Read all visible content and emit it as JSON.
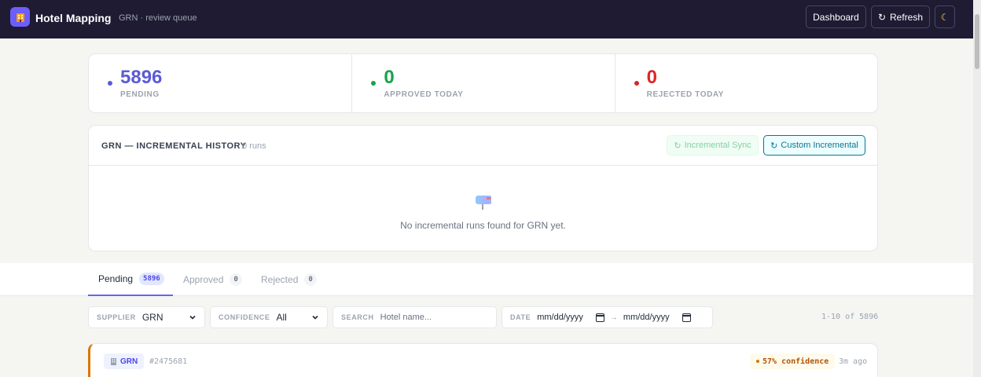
{
  "header": {
    "title": "Hotel Mapping",
    "subtitle": "GRN · review queue",
    "logo_icon": "hotel-icon",
    "dashboard_label": "Dashboard",
    "refresh_label": "Refresh",
    "refresh_icon": "↻",
    "theme_icon": "☾"
  },
  "stats": [
    {
      "value": "5896",
      "label": "PENDING",
      "color": "#5b5bd6"
    },
    {
      "value": "0",
      "label": "APPROVED TODAY",
      "color": "#16a34a"
    },
    {
      "value": "0",
      "label": "REJECTED TODAY",
      "color": "#dc2626"
    }
  ],
  "history": {
    "title": "GRN — INCREMENTAL HISTORY",
    "runs": "0 runs",
    "sync_label": "Incremental Sync",
    "custom_label": "Custom Incremental",
    "btn_icon": "↻",
    "empty_icon": "mailbox-icon",
    "empty_text": "No incremental runs found for GRN yet."
  },
  "tabs": [
    {
      "label": "Pending",
      "count": "5896",
      "active": true
    },
    {
      "label": "Approved",
      "count": "0",
      "active": false
    },
    {
      "label": "Rejected",
      "count": "0",
      "active": false
    }
  ],
  "filters": {
    "supplier_label": "SUPPLIER",
    "supplier_value": "GRN",
    "confidence_label": "CONFIDENCE",
    "confidence_value": "All",
    "search_label": "SEARCH",
    "search_placeholder": "Hotel name...",
    "date_label": "DATE",
    "date_from": "mm/dd/yyyy",
    "date_to": "mm/dd/yyyy",
    "date_arrow": "→"
  },
  "range_info": "1-10 of 5896",
  "rows": [
    {
      "supplier": "GRN",
      "id": "#2475681",
      "confidence": "57% confidence",
      "time": "3m ago"
    }
  ],
  "colors": {
    "topbar": "#1e1b33",
    "accent": "#6366f1",
    "warning": "#d97706"
  }
}
